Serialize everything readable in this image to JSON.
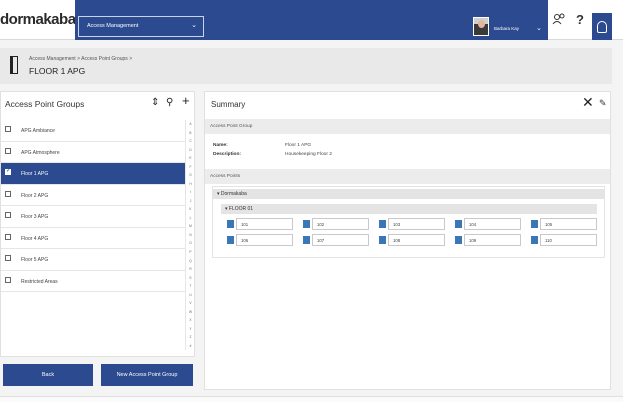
{
  "brand": {
    "name": "dormakaba"
  },
  "header": {
    "module_select": "Access Management",
    "user_name": "Barbara Kay",
    "icons": [
      "chevron-down-icon",
      "user-avatar",
      "chevron-down-icon",
      "users-icon",
      "help-icon",
      "bell-icon"
    ],
    "help_label": "?"
  },
  "breadcrumb": {
    "path": "Access Management > Access Point Groups >",
    "title": "FLOOR 1 APG"
  },
  "left_panel": {
    "title": "Access Point Groups",
    "groups": [
      {
        "label": "APG Ambiance",
        "selected": false
      },
      {
        "label": "APG Atmosphere",
        "selected": false
      },
      {
        "label": "Floor 1 APG",
        "selected": true
      },
      {
        "label": "Floor 2 APG",
        "selected": false
      },
      {
        "label": "Floor 3 APG",
        "selected": false
      },
      {
        "label": "Floor 4 APG",
        "selected": false
      },
      {
        "label": "Floor 5 APG",
        "selected": false
      },
      {
        "label": "Restricted Areas",
        "selected": false
      }
    ],
    "alphabet": [
      "A",
      "B",
      "C",
      "D",
      "E",
      "F",
      "G",
      "H",
      "I",
      "J",
      "K",
      "L",
      "M",
      "N",
      "O",
      "P",
      "Q",
      "R",
      "S",
      "T",
      "U",
      "V",
      "W",
      "X",
      "Y",
      "Z",
      "#"
    ],
    "back_label": "Back",
    "new_label": "New Access Point Group"
  },
  "summary": {
    "title": "Summary",
    "group_section": "Access Point Group",
    "name_label": "Name:",
    "name_value": "Floor 1 APG",
    "desc_label": "Description:",
    "desc_value": "Housekeeping Floor 2",
    "points_section": "Access Points",
    "site": "Dormakaba",
    "floor": "FLOOR 01",
    "access_points": [
      "101",
      "102",
      "103",
      "104",
      "105",
      "106",
      "107",
      "108",
      "109",
      "110"
    ]
  },
  "colors": {
    "primary": "#2b4a8f",
    "brand_red": "#d2232a",
    "door_blue": "#3b76b5"
  }
}
